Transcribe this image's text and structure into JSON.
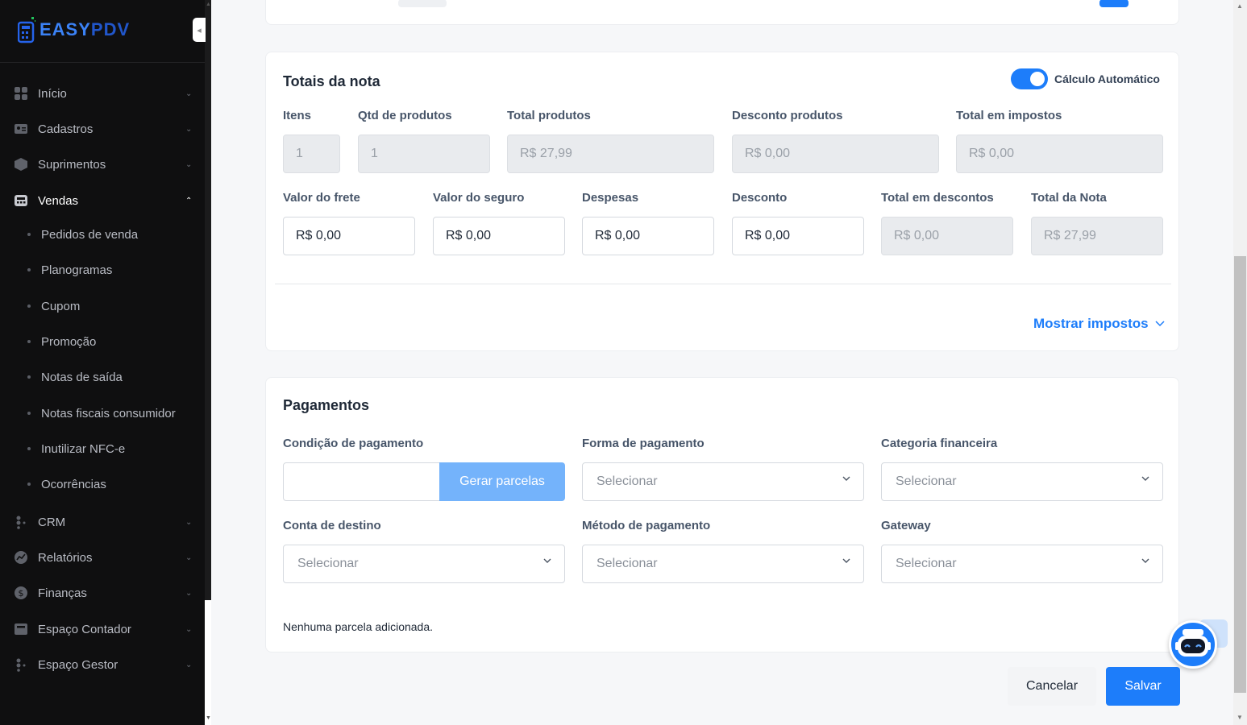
{
  "brand": {
    "name_part1": "EASY",
    "name_part2": "PDV"
  },
  "sidebar": {
    "items": [
      {
        "label": "Início",
        "icon": "home-icon"
      },
      {
        "label": "Cadastros",
        "icon": "id-card-icon"
      },
      {
        "label": "Suprimentos",
        "icon": "box-icon"
      },
      {
        "label": "Vendas",
        "icon": "cash-register-icon"
      },
      {
        "label": "CRM",
        "icon": "users-icon"
      },
      {
        "label": "Relatórios",
        "icon": "chart-icon"
      },
      {
        "label": "Finanças",
        "icon": "dollar-icon"
      },
      {
        "label": "Espaço Contador",
        "icon": "calculator-icon"
      },
      {
        "label": "Espaço Gestor",
        "icon": "manager-icon"
      }
    ],
    "vendas_sub": [
      "Pedidos de venda",
      "Planogramas",
      "Cupom",
      "Promoção",
      "Notas de saída",
      "Notas fiscais consumidor",
      "Inutilizar NFC-e",
      "Ocorrências"
    ]
  },
  "totais": {
    "title": "Totais da nota",
    "auto_calc_label": "Cálculo Automático",
    "auto_calc_on": true,
    "row1": [
      {
        "label": "Itens",
        "value": "1"
      },
      {
        "label": "Qtd de produtos",
        "value": "1"
      },
      {
        "label": "Total produtos",
        "value": "R$ 27,99"
      },
      {
        "label": "Desconto produtos",
        "value": "R$ 0,00"
      },
      {
        "label": "Total em impostos",
        "value": "R$ 0,00"
      }
    ],
    "row2": [
      {
        "label": "Valor do frete",
        "value": "R$ 0,00"
      },
      {
        "label": "Valor do seguro",
        "value": "R$ 0,00"
      },
      {
        "label": "Despesas",
        "value": "R$ 0,00"
      },
      {
        "label": "Desconto",
        "value": "R$ 0,00"
      },
      {
        "label": "Total em descontos",
        "value": "R$ 0,00"
      },
      {
        "label": "Total da Nota",
        "value": "R$ 27,99"
      }
    ],
    "show_taxes": "Mostrar impostos"
  },
  "pagamentos": {
    "title": "Pagamentos",
    "cond_label": "Condição de pagamento",
    "cond_value": "",
    "gen_button": "Gerar parcelas",
    "forma_label": "Forma de pagamento",
    "categoria_label": "Categoria financeira",
    "conta_label": "Conta de destino",
    "metodo_label": "Método de pagamento",
    "gateway_label": "Gateway",
    "select_placeholder": "Selecionar",
    "empty_msg": "Nenhuma parcela adicionada."
  },
  "actions": {
    "cancel": "Cancelar",
    "save": "Salvar"
  },
  "colors": {
    "accent": "#1d7dfa",
    "sidebar_bg": "#0f0f10",
    "button_light": "#74b3fb"
  }
}
